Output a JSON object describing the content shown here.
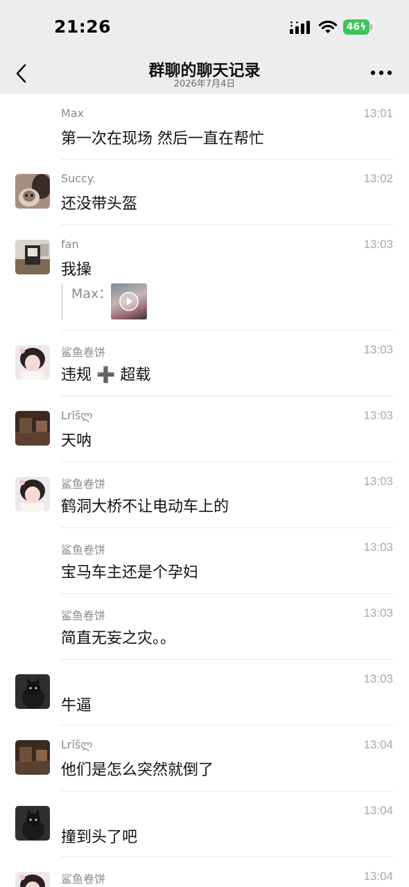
{
  "status": {
    "time": "21:26",
    "battery": "46"
  },
  "header": {
    "title": "群聊的聊天记录",
    "date": "2026年7月4日"
  },
  "messages": [
    {
      "sender": "Max",
      "time": "13:01",
      "text": "第一次在现场 然后一直在帮忙",
      "avatar": "none"
    },
    {
      "sender": "Succy.",
      "time": "13:02",
      "text": "还没带头盔",
      "avatar": "cat-selfie"
    },
    {
      "sender": "fan",
      "time": "13:03",
      "text": "我操",
      "avatar": "room-photo",
      "quote": {
        "name": "Max：",
        "media": "video-thumbnail"
      }
    },
    {
      "sender": "鲨鱼卷饼",
      "time": "13:03",
      "text": "违规 ➕ 超载",
      "avatar": "girl-selfie"
    },
    {
      "sender": "Lrĭšლ",
      "time": "13:03",
      "text": "天呐",
      "avatar": "dark-interior"
    },
    {
      "sender": "鲨鱼卷饼",
      "time": "13:03",
      "text": "鹤洞大桥不让电动车上的",
      "avatar": "girl-selfie"
    },
    {
      "sender": "鲨鱼卷饼",
      "time": "13:03",
      "text": "宝马车主还是个孕妇",
      "avatar": "none"
    },
    {
      "sender": "鲨鱼卷饼",
      "time": "13:03",
      "text": "简直无妄之灾。。",
      "avatar": "none"
    },
    {
      "sender": "",
      "time": "13:03",
      "text": "牛逼",
      "avatar": "black-cat"
    },
    {
      "sender": "Lrĭšლ",
      "time": "13:04",
      "text": "他们是怎么突然就倒了",
      "avatar": "dark-interior"
    },
    {
      "sender": "",
      "time": "13:04",
      "text": "撞到头了吧",
      "avatar": "black-cat"
    },
    {
      "sender": "鲨鱼卷饼",
      "time": "13:04",
      "text": "",
      "avatar": "girl-selfie"
    }
  ],
  "colors": {
    "header_bg": "#ededed",
    "separator": "#e6e6e6",
    "meta_text": "#8a8a8a",
    "battery": "#3cc45b"
  }
}
